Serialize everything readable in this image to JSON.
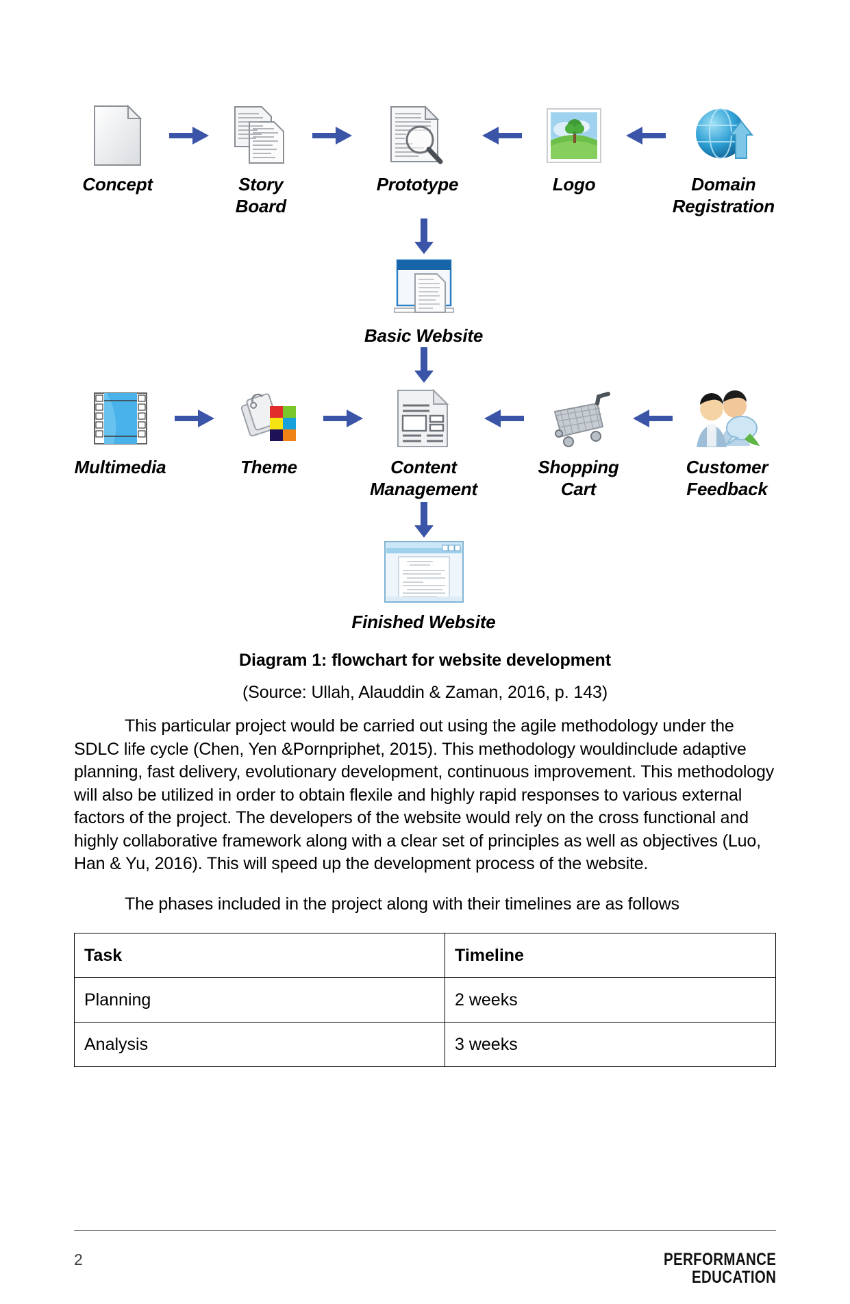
{
  "document": {
    "page_number": "2",
    "brand_line1": "PERFORMANCE",
    "brand_line2": "EDUCATION"
  },
  "diagram": {
    "caption_bold": "Diagram 1: flowchart for website development",
    "caption_source": "(Source: Ullah, Alauddin & Zaman, 2016, p. 143)",
    "row1": [
      {
        "label": "Concept",
        "icon": "document-page-icon"
      },
      {
        "label": "Story Board",
        "icon": "stacked-documents-icon"
      },
      {
        "label": "Prototype",
        "icon": "document-magnifier-icon"
      },
      {
        "label": "Logo",
        "icon": "picture-landscape-icon"
      },
      {
        "label": "Domain\nRegistration",
        "icon": "globe-upload-icon"
      }
    ],
    "row1_arrows": [
      "arrow-right",
      "arrow-right",
      "arrow-left",
      "arrow-left"
    ],
    "mid_node": {
      "label": "Basic Website",
      "icon": "browser-window-document-icon"
    },
    "row2": [
      {
        "label": "Multimedia",
        "icon": "film-strip-icon"
      },
      {
        "label": "Theme",
        "icon": "tags-color-swatch-icon"
      },
      {
        "label": "Content\nManagement",
        "icon": "content-page-layout-icon"
      },
      {
        "label": "Shopping\nCart",
        "icon": "shopping-cart-icon"
      },
      {
        "label": "Customer\nFeedback",
        "icon": "users-feedback-icon"
      }
    ],
    "row2_arrows": [
      "arrow-right",
      "arrow-right",
      "arrow-left",
      "arrow-left"
    ],
    "end_node": {
      "label": "Finished Website",
      "icon": "browser-window-page-icon"
    },
    "arrow_color": "#3a54a8"
  },
  "body": {
    "paragraph1": "This particular project would be carried out using the agile methodology under the SDLC life cycle (Chen, Yen &Pornpriphet, 2015). This methodology wouldinclude adaptive planning, fast delivery, evolutionary development, continuous improvement. This methodology will also be utilized in order to obtain flexile and highly rapid responses to various external factors of the project. The developers of the website would rely on the cross functional and highly collaborative framework along with a clear set of principles as well as objectives (Luo, Han & Yu, 2016). This will speed up the development process of the website.",
    "paragraph2": "The phases included in the project along with their timelines are as follows"
  },
  "table": {
    "headers": [
      "Task",
      "Timeline"
    ],
    "rows": [
      [
        "Planning",
        "2 weeks"
      ],
      [
        "Analysis",
        "3 weeks"
      ]
    ]
  }
}
